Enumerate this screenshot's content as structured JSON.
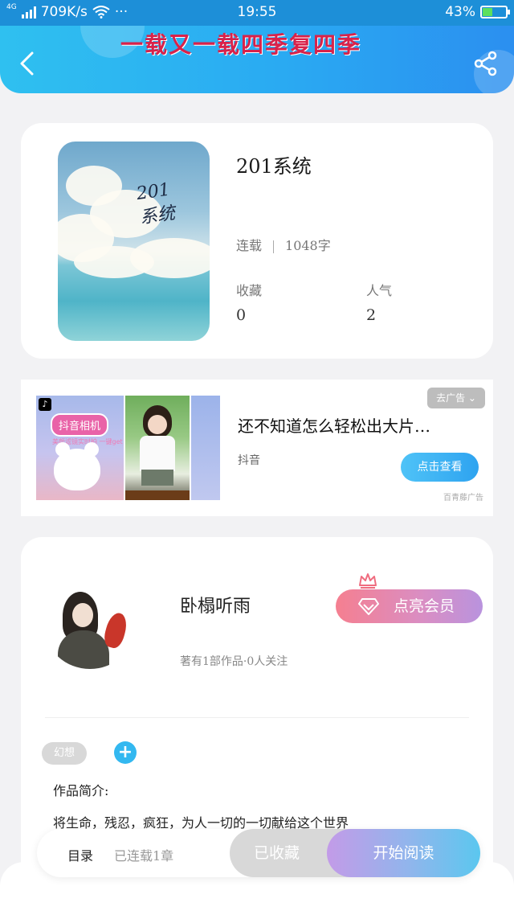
{
  "status_bar": {
    "network_type": "4G",
    "speed": "709K/s",
    "more": "···",
    "time": "19:55",
    "battery_percent": "43%",
    "battery_level": 0.43
  },
  "header": {
    "title_art": "一载又一载四季复四季",
    "gradient_colors": [
      "#2fc0f0",
      "#2b8ff0"
    ]
  },
  "book": {
    "cover_text_line1": "201",
    "cover_text_line2": "系统",
    "title": "201系统",
    "status": "连载",
    "word_count": "1048字",
    "favorites_label": "收藏",
    "favorites_value": "0",
    "popularity_label": "人气",
    "popularity_value": "2"
  },
  "ad": {
    "pill_text": "抖音相机",
    "sub_text": "美颜滤镜实时拍 一键get",
    "close_label": "去广告 ⌄",
    "title": "还不知道怎么轻松出大片…",
    "source": "抖音",
    "cta_label": "点击查看",
    "provider": "百青藤广告"
  },
  "author": {
    "name": "卧榻听雨",
    "meta": "著有1部作品·0人关注",
    "vip_label": "点亮会员",
    "vip_colors": [
      "#f57f90",
      "#b993de"
    ]
  },
  "tags": {
    "items": [
      "幻想"
    ],
    "add_symbol": "+"
  },
  "intro": {
    "label": "作品简介:",
    "text": "将生命，残忍，疯狂，为人一切的一切献给这个世界"
  },
  "bottom_bar": {
    "toc_label": "目录",
    "progress": "已连载1章",
    "collected_label": "已收藏",
    "read_label": "开始阅读"
  }
}
